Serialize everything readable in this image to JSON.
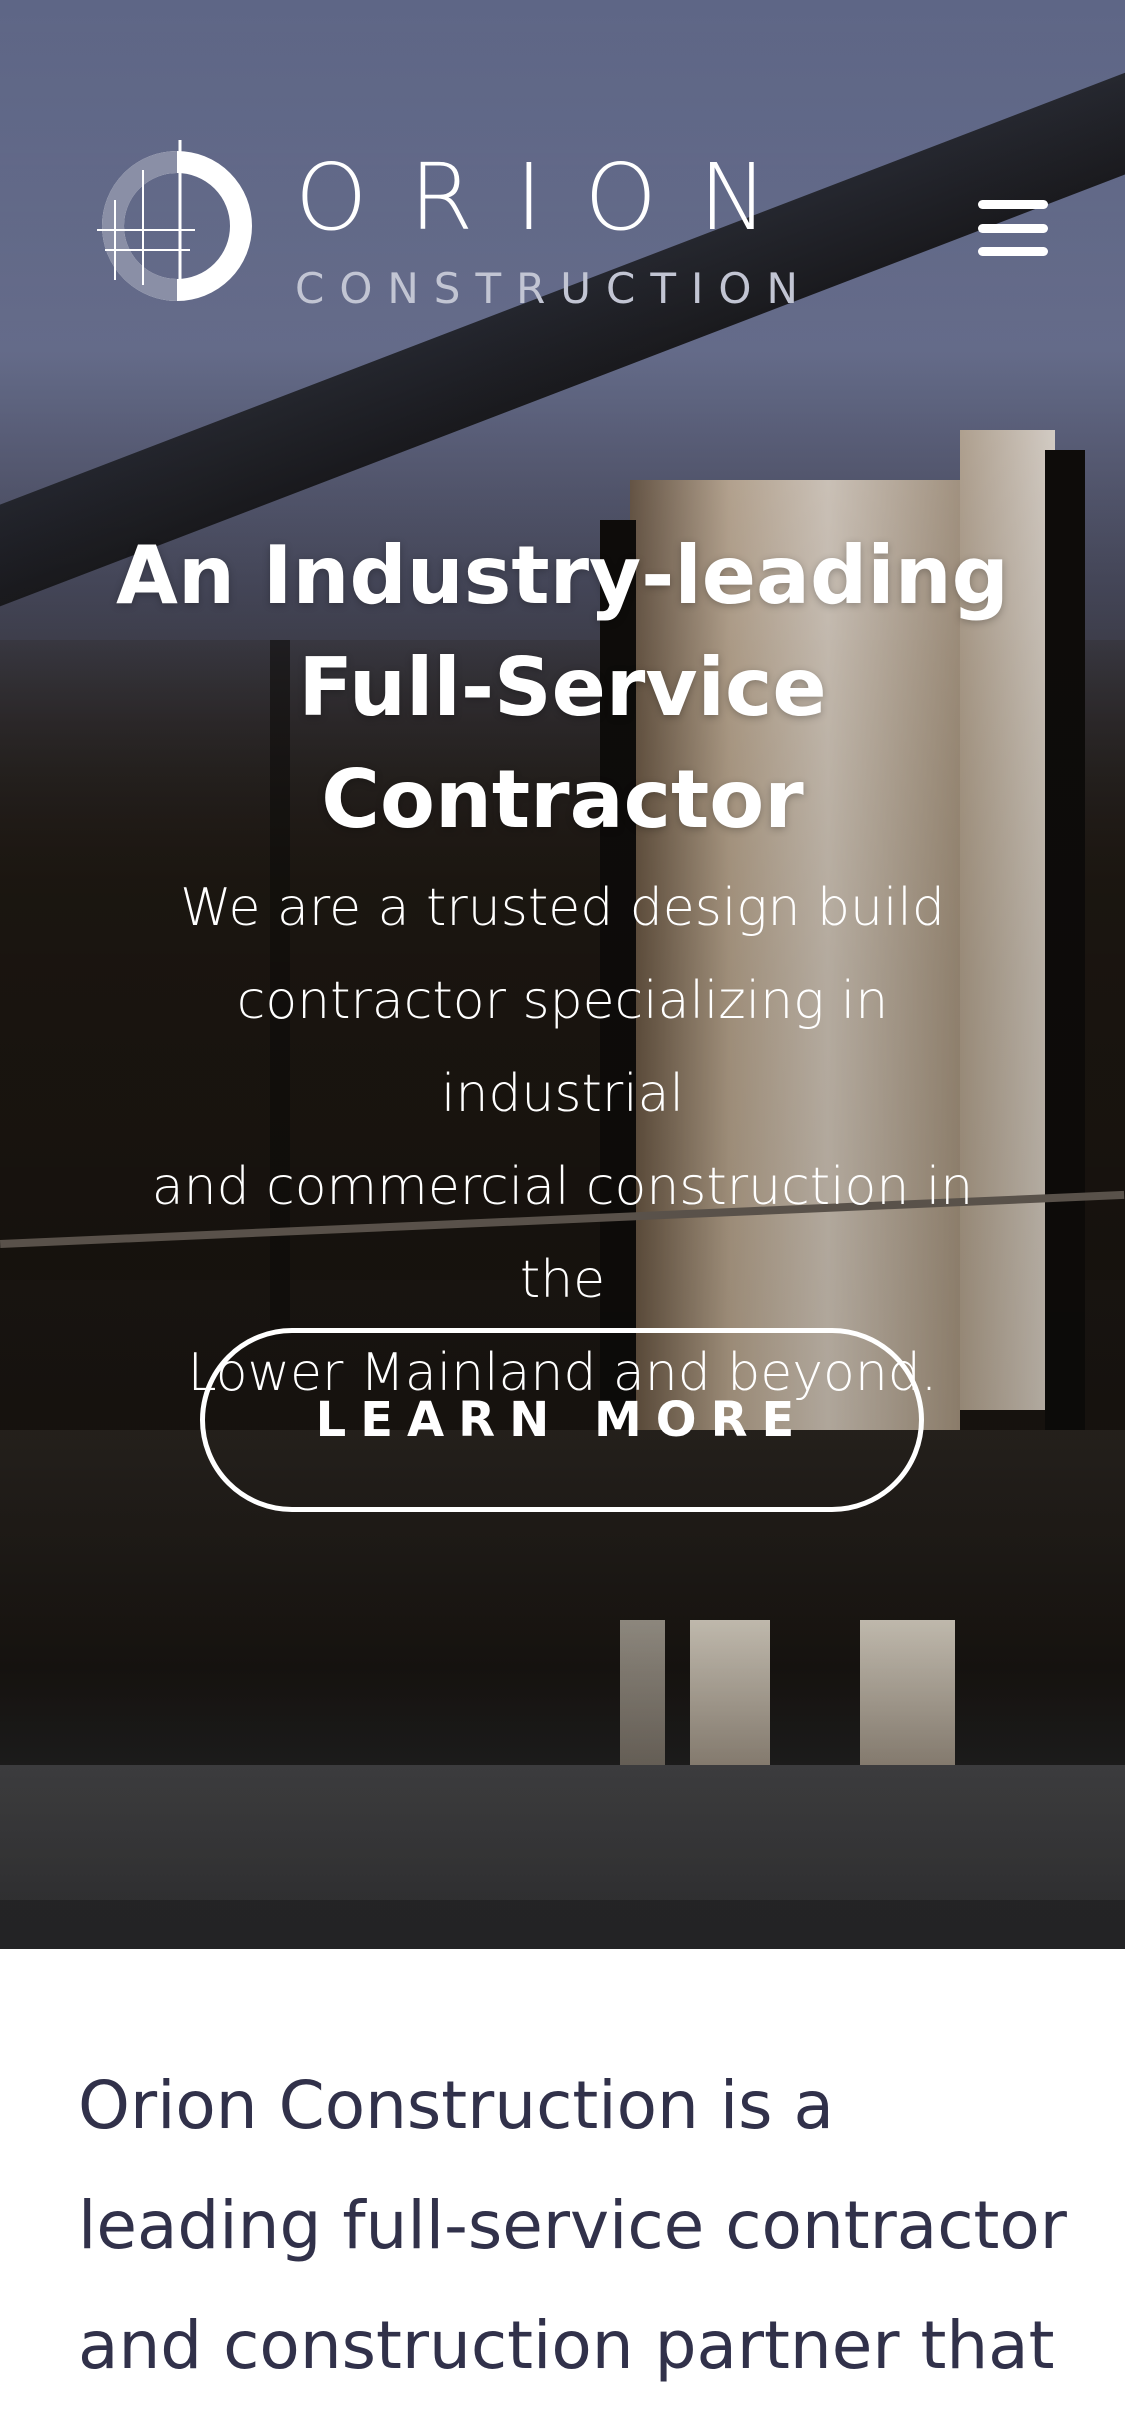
{
  "header": {
    "brand_name": "ORION",
    "brand_tagline": "CONSTRUCTION",
    "logo_icon": "orion-circle-crosshair-logo",
    "menu_icon": "hamburger-icon"
  },
  "hero": {
    "headline_lines": [
      "An Industry-leading",
      "Full-Service",
      "Contractor"
    ],
    "subtext_lines": [
      "We are a trusted design build",
      "contractor specializing in industrial",
      "and commercial construction in the",
      "Lower Mainland and beyond."
    ],
    "cta_label": "LEARN MORE"
  },
  "intro": {
    "text_lines": [
      "Orion Construction is a",
      "leading full-service contractor",
      "and construction partner that"
    ]
  },
  "colors": {
    "hero_text": "#ffffff",
    "tagline": "#c2c5d3",
    "intro_text": "#31314a",
    "sky": "#5e6686"
  }
}
